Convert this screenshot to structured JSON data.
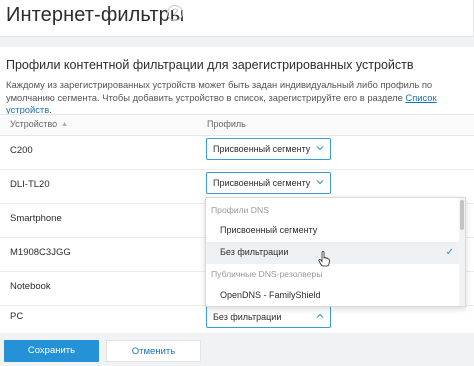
{
  "header": {
    "title": "Интернет-фильтры",
    "help_icon": "?"
  },
  "section": {
    "title": "Профили контентной фильтрации для зарегистрированных устройств",
    "description_text": "Каждому из зарегистрированных устройств может быть задан индивидуальный либо профиль по умолчанию сегмента. Чтобы добавить устройство в список, зарегистрируйте его в разделе ",
    "description_link": "Список устройств",
    "description_end": "."
  },
  "table": {
    "col_device": "Устройство",
    "col_profile": "Профиль",
    "rows": [
      {
        "device": "C200",
        "profile": "Присвоенный сегменту"
      },
      {
        "device": "DLI-TL20",
        "profile": "Присвоенный сегменту"
      },
      {
        "device": "Smartphone",
        "profile": ""
      },
      {
        "device": "M1908C3JGG",
        "profile": ""
      },
      {
        "device": "Notebook",
        "profile": ""
      },
      {
        "device": "PC",
        "profile": "Без фильтрации"
      }
    ]
  },
  "dropdown": {
    "group1": "Профили DNS",
    "item1": "Присвоенный сегменту",
    "item2": "Без фильтрации",
    "group2": "Публичные DNS-резолверы",
    "item3": "OpenDNS - FamilyShield",
    "selected": "Без фильтрации"
  },
  "buttons": {
    "save": "Сохранить",
    "cancel": "Отменить"
  },
  "colors": {
    "accent": "#2592d8",
    "select_border": "#3a9bd5",
    "footer_bg": "#f1f2f4"
  },
  "icons": {
    "help": "help-icon",
    "sort": "sort-asc-icon",
    "chevron_down": "chevron-down-icon",
    "chevron_up": "chevron-up-icon",
    "check": "check-icon",
    "cursor": "hand-cursor-icon"
  }
}
